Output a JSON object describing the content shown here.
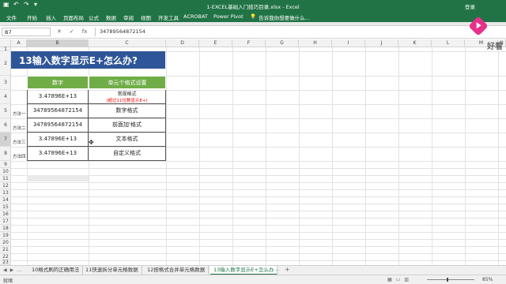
{
  "window": {
    "title": "1-EXCEL基础入门技巧目录.xlsx - Excel",
    "login": "登录"
  },
  "qat": [
    "save-icon",
    "undo-icon",
    "redo-icon",
    "customize-icon"
  ],
  "menu": {
    "tabs": [
      "文件",
      "开始",
      "插入",
      "页面布局",
      "公式",
      "数据",
      "审阅",
      "视图",
      "开发工具",
      "ACROBAT",
      "Power Pivot"
    ],
    "tell_me": "告诉我你想要做什么..."
  },
  "logo": {
    "brand": "好看"
  },
  "formula": {
    "name_box": "B7",
    "cancel": "✕",
    "enter": "✓",
    "fx": "fx",
    "value": "34789564872154"
  },
  "columns": [
    "A",
    "B",
    "C",
    "D",
    "E",
    "F",
    "G",
    "H",
    "I",
    "J",
    "K",
    "L",
    "M",
    "N"
  ],
  "rows": [
    "1",
    "2",
    "3",
    "4",
    "5",
    "6",
    "7",
    "8",
    "9",
    "10",
    "11",
    "12",
    "13",
    "14",
    "15",
    "16",
    "17",
    "18",
    "19",
    "20",
    "21",
    "22",
    "23"
  ],
  "sheet": {
    "title": "13输入数字显示E+怎么办?",
    "headers": [
      "数字",
      "单元个格式设置"
    ],
    "rows": [
      {
        "side": "",
        "number": "3.47896E+13",
        "format": "常规格式",
        "note": "(超过11位数显示E+)"
      },
      {
        "side": "方法一",
        "number": "34789564872154",
        "format": "数字格式"
      },
      {
        "side": "方法二",
        "number": "34789564872154",
        "format": "前面加'格式"
      },
      {
        "side": "方法三",
        "number": "3.47896E+13",
        "format": "文本格式"
      },
      {
        "side": "方法四",
        "number": "3.47896E+13",
        "format": "自定义格式"
      }
    ]
  },
  "sheet_tabs": {
    "tabs": [
      "10格式刷的正确用法",
      "11快速拆分单元格数据",
      "12按格式合并单元格数据",
      "13输入数字显示E+怎么办"
    ],
    "active_index": 3,
    "more": "...",
    "add": "+"
  },
  "status": {
    "ready": "就绪",
    "zoom": "85%"
  }
}
